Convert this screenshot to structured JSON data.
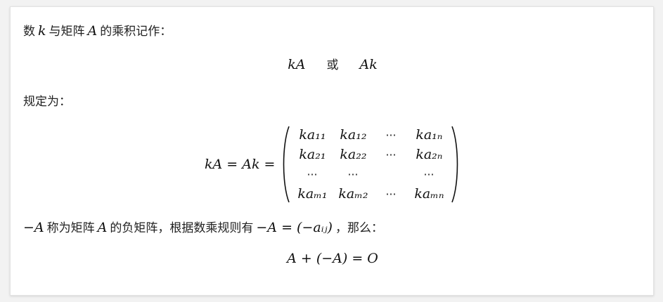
{
  "intro": {
    "p1": "数",
    "k": "k",
    "p2": "与矩阵",
    "A": "A",
    "p3": "的乘积记作："
  },
  "notation": {
    "left": "kA",
    "or": "或",
    "right": "Ak"
  },
  "rule_label": "规定为：",
  "matrix": {
    "lhs": "kA = Ak =",
    "rows": [
      [
        "ka₁₁",
        "ka₁₂",
        "⋯",
        "ka₁ₙ"
      ],
      [
        "ka₂₁",
        "ka₂₂",
        "⋯",
        "ka₂ₙ"
      ],
      [
        "⋯",
        "⋯",
        "",
        "⋯"
      ],
      [
        "kaₘ₁",
        "kaₘ₂",
        "⋯",
        "kaₘₙ"
      ]
    ]
  },
  "negative": {
    "negA": "−A",
    "p1": "称为矩阵",
    "A": "A",
    "p2": "的负矩阵，根据数乘规则有",
    "eq": "−A = (−aᵢⱼ)",
    "p3": "，那么："
  },
  "final_eq": "A + (−A) = O"
}
